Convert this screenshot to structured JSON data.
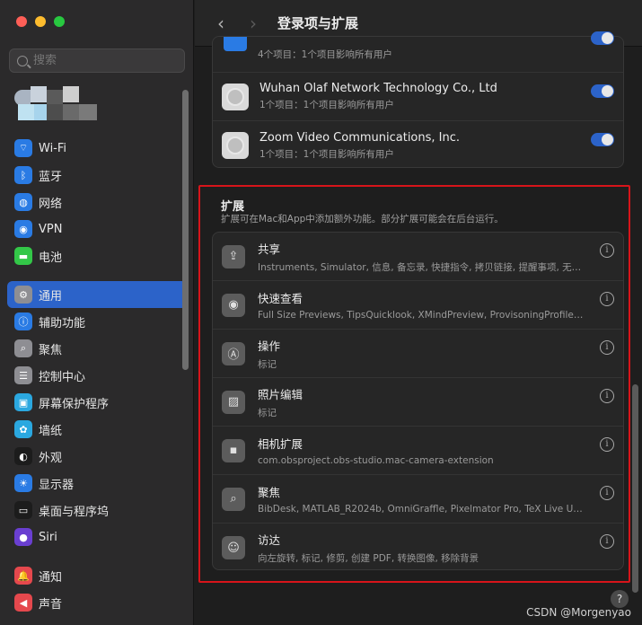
{
  "window": {
    "title": "登录项与扩展"
  },
  "sidebar": {
    "search_placeholder": "搜索",
    "items": [
      {
        "label": "Wi-Fi",
        "icon": "wifi-icon",
        "color": "#2a7be4",
        "glyph": "⌔"
      },
      {
        "label": "蓝牙",
        "icon": "bluetooth-icon",
        "color": "#2a7be4",
        "glyph": "ᛒ"
      },
      {
        "label": "网络",
        "icon": "network-icon",
        "color": "#2a7be4",
        "glyph": "◍"
      },
      {
        "label": "VPN",
        "icon": "vpn-icon",
        "color": "#2a7be4",
        "glyph": "◉"
      },
      {
        "label": "电池",
        "icon": "battery-icon",
        "color": "#33c748",
        "glyph": "▬"
      },
      {
        "label": "通用",
        "icon": "gear-icon",
        "color": "#8e8e93",
        "glyph": "⚙",
        "active": true
      },
      {
        "label": "辅助功能",
        "icon": "accessibility-icon",
        "color": "#2a7be4",
        "glyph": "ⓘ"
      },
      {
        "label": "聚焦",
        "icon": "spotlight-icon",
        "color": "#8e8e93",
        "glyph": "⌕"
      },
      {
        "label": "控制中心",
        "icon": "control-center-icon",
        "color": "#8e8e93",
        "glyph": "☰"
      },
      {
        "label": "屏幕保护程序",
        "icon": "screensaver-icon",
        "color": "#2ba8e0",
        "glyph": "▣"
      },
      {
        "label": "墙纸",
        "icon": "wallpaper-icon",
        "color": "#2ba8e0",
        "glyph": "✿"
      },
      {
        "label": "外观",
        "icon": "appearance-icon",
        "color": "#1c1c1c",
        "glyph": "◐"
      },
      {
        "label": "显示器",
        "icon": "display-icon",
        "color": "#2a7be4",
        "glyph": "☀"
      },
      {
        "label": "桌面与程序坞",
        "icon": "dock-icon",
        "color": "#1c1c1c",
        "glyph": "▭"
      },
      {
        "label": "Siri",
        "icon": "siri-icon",
        "color": "#6a3fd1",
        "glyph": "●"
      },
      {
        "label": "通知",
        "icon": "notifications-icon",
        "color": "#e5484d",
        "glyph": "🔔"
      },
      {
        "label": "声音",
        "icon": "sound-icon",
        "color": "#e5484d",
        "glyph": "◀"
      }
    ]
  },
  "login_items": [
    {
      "name": "",
      "sub": "4个项目：1个项目影响所有用户"
    },
    {
      "name": "Wuhan Olaf Network Technology Co., Ltd",
      "sub": "1个项目：1个项目影响所有用户"
    },
    {
      "name": "Zoom Video Communications, Inc.",
      "sub": "1个项目：1个项目影响所有用户"
    }
  ],
  "extensions": {
    "title": "扩展",
    "description": "扩展可在Mac和App中添加额外功能。部分扩展可能会在后台运行。",
    "items": [
      {
        "name": "共享",
        "sub": "Instruments, Simulator, 信息, 备忘录, 快捷指令, 拷贝链接, 提醒事项, 无…",
        "icon": "share-icon",
        "glyph": "⇪"
      },
      {
        "name": "快速查看",
        "sub": "Full Size Previews, TipsQuicklook, XMindPreview, ProvisoningProfile…",
        "icon": "eye-icon",
        "glyph": "◉"
      },
      {
        "name": "操作",
        "sub": "标记",
        "icon": "markup-icon",
        "glyph": "Ⓐ"
      },
      {
        "name": "照片编辑",
        "sub": "标记",
        "icon": "photo-edit-icon",
        "glyph": "▨"
      },
      {
        "name": "相机扩展",
        "sub": "com.obsproject.obs-studio.mac-camera-extension",
        "icon": "camera-extension-icon",
        "glyph": "▪"
      },
      {
        "name": "聚焦",
        "sub": "BibDesk, MATLAB_R2024b, OmniGraffle, Pixelmator Pro, TeX Live U…",
        "icon": "spotlight-icon",
        "glyph": "⌕"
      },
      {
        "name": "访达",
        "sub": "向左旋转, 标记, 修剪, 创建 PDF, 转换图像, 移除背景",
        "icon": "finder-icon",
        "glyph": "☺"
      }
    ]
  },
  "help": "?",
  "watermark": "CSDN @Morgenyao"
}
